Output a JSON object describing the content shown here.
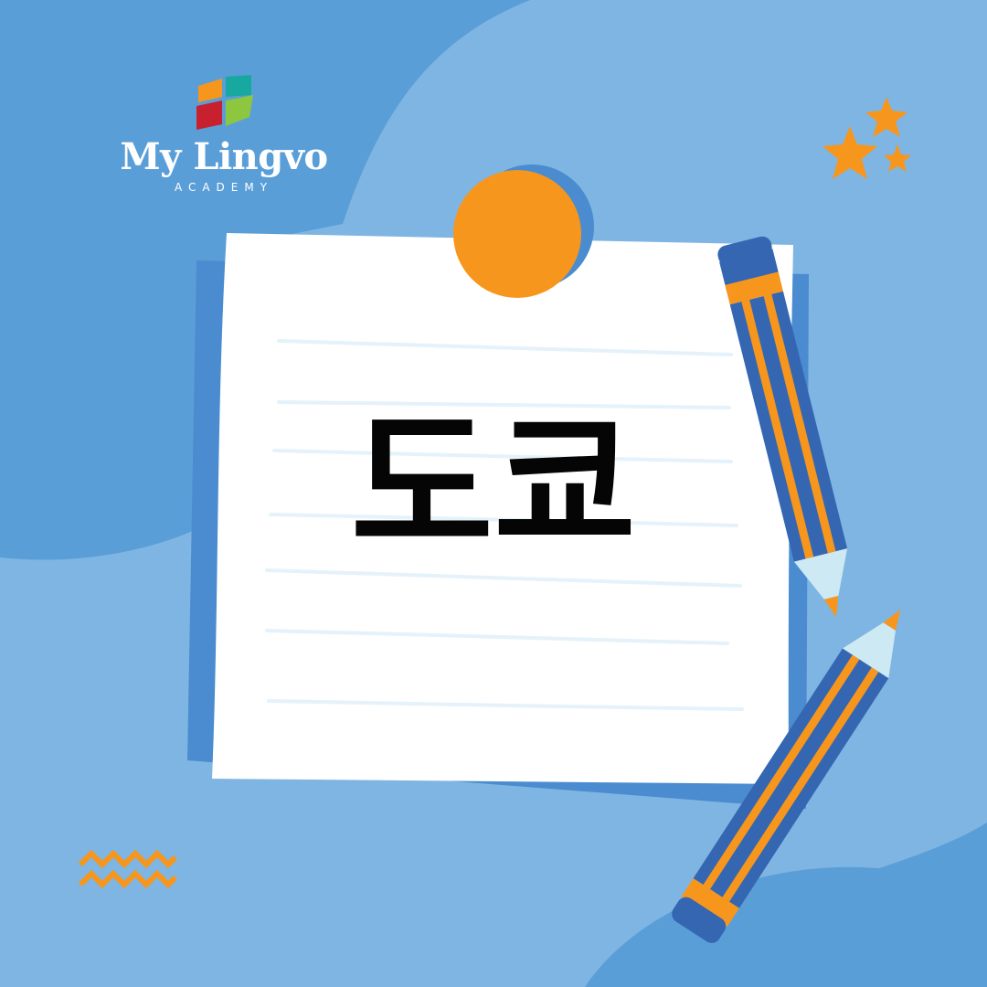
{
  "brand": {
    "name": "My Lingvo",
    "subtitle": "ACADEMY"
  },
  "note": {
    "word": "도쿄"
  },
  "colors": {
    "background_dark": "#5a9ed8",
    "background_light": "#7fb5e2",
    "paper": "#ffffff",
    "pin": "#f7961d",
    "pencil_blue": "#3566b2",
    "pencil_orange": "#f7961d",
    "pencil_tip": "#cce9f4",
    "accent": "#f7961d"
  },
  "icons": [
    "logo-mark-icon",
    "stars-icon",
    "pushpin-icon",
    "pencil-icon",
    "zigzag-icon"
  ]
}
